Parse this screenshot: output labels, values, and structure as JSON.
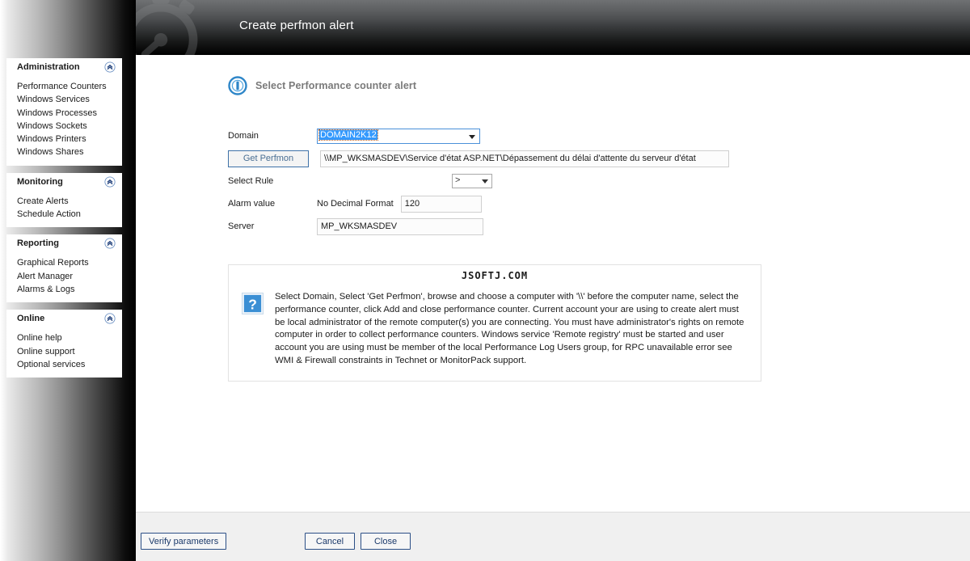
{
  "header": {
    "title": "Create perfmon alert",
    "watermark_icon": "stopwatch-icon"
  },
  "sidebar": {
    "panels": [
      {
        "title": "Administration",
        "collapse_icon": "double-chevron-up-icon",
        "items": [
          "Performance Counters",
          "Windows Services",
          "Windows Processes",
          "Windows Sockets",
          "Windows Printers",
          "Windows Shares"
        ]
      },
      {
        "title": "Monitoring",
        "collapse_icon": "double-chevron-up-icon",
        "items": [
          "Create Alerts",
          "Schedule Action"
        ]
      },
      {
        "title": "Reporting",
        "collapse_icon": "double-chevron-up-icon",
        "items": [
          "Graphical Reports",
          "Alert Manager",
          "Alarms & Logs"
        ]
      },
      {
        "title": "Online",
        "collapse_icon": "double-chevron-up-icon",
        "items": [
          "Online help",
          "Online support",
          "Optional services"
        ]
      }
    ]
  },
  "main": {
    "section_icon": "info-circle-icon",
    "section_title": "Select  Performance counter alert",
    "form": {
      "domain_label": "Domain",
      "domain_value": "DOMAIN2K12",
      "get_perfmon_label": "Get Perfmon",
      "counter_path": "\\\\MP_WKSMASDEV\\Service d'état ASP.NET\\Dépassement du délai d'attente du serveur d'état",
      "rule_label": "Select Rule",
      "rule_value": ">",
      "alarm_label": "Alarm value",
      "alarm_format_label": "No Decimal Format",
      "alarm_value": "120",
      "server_label": "Server",
      "server_value": "MP_WKSMASDEV"
    },
    "help": {
      "watermark": "JSOFTJ.COM",
      "icon": "question-mark-icon",
      "text": "Select Domain, Select 'Get Perfmon', browse and choose a computer with '\\\\' before the computer name, select the performance counter, click Add and close performance counter. Current account your are using to create alert must be local administrator of the remote computer(s) you are connecting. You must have administrator's rights on remote computer in order to collect performance counters. Windows service 'Remote registry' must be started and user account you are using must be member of the local Performance Log Users group, for RPC unavailable error see WMI & Firewall constraints in Technet or MonitorPack support."
    }
  },
  "footer": {
    "verify_label": "Verify parameters",
    "cancel_label": "Cancel",
    "close_label": "Close"
  },
  "colors": {
    "accent_blue": "#3399ff",
    "button_border_blue": "#2b4f86",
    "header_dark": "#000000",
    "help_icon_blue": "#3b8fd4"
  }
}
